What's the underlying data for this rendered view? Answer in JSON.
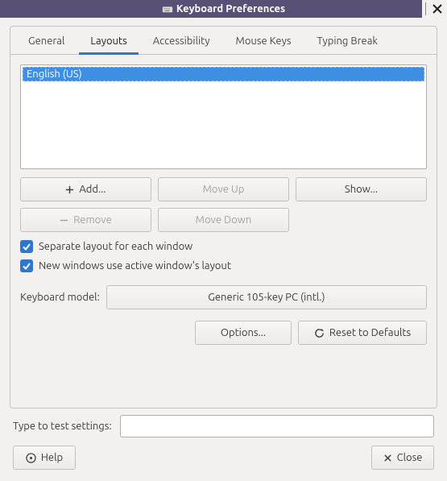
{
  "window": {
    "title": "Keyboard Preferences"
  },
  "tabs": {
    "general": "General",
    "layouts": "Layouts",
    "accessibility": "Accessibility",
    "mouse_keys": "Mouse Keys",
    "typing_break": "Typing Break"
  },
  "layouts_tab": {
    "list": {
      "items": [
        {
          "label": "English (US)"
        }
      ]
    },
    "buttons": {
      "add": "Add...",
      "move_up": "Move Up",
      "show": "Show...",
      "remove": "Remove",
      "move_down": "Move Down"
    },
    "checkboxes": {
      "separate_layout": "Separate layout for each window",
      "new_windows_active": "New windows use active window's layout"
    },
    "model_label": "Keyboard model:",
    "model_value": "Generic 105-key PC (intl.)",
    "options_btn": "Options...",
    "reset_btn": "Reset to Defaults"
  },
  "footer": {
    "test_label": "Type to test settings:",
    "test_value": "",
    "help": "Help",
    "close": "Close"
  }
}
